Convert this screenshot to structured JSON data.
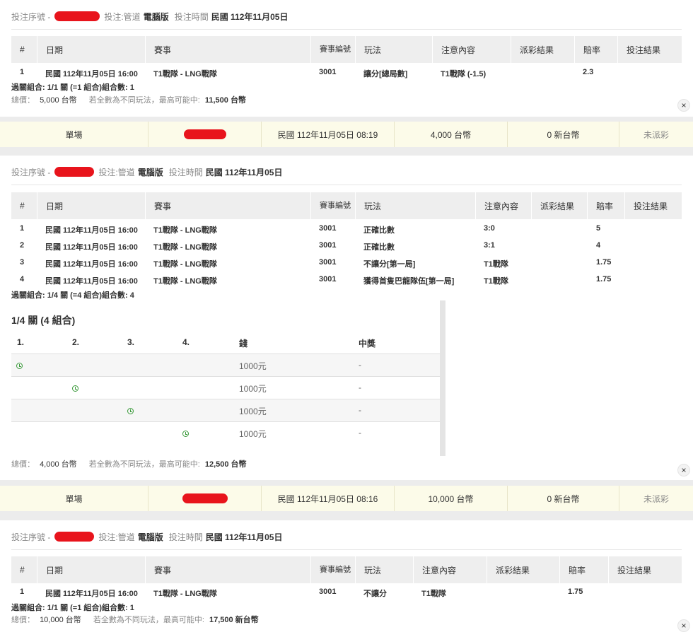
{
  "labels": {
    "bet_serial": "投注序號 -",
    "bet_channel": "投注:管道",
    "bet_channel_value": "電腦版",
    "bet_time": "投注時間",
    "close": "×"
  },
  "columns": {
    "index": "#",
    "date": "日期",
    "event": "賽事",
    "event_no": "賽事編號",
    "play": "玩法",
    "content": "注意內容",
    "payout": "派彩結果",
    "odds": "賠率",
    "result": "投注結果"
  },
  "bet1": {
    "date": "民國 112年11月05日",
    "rows": [
      {
        "no": "1",
        "date": "民國 112年11月05日 16:00",
        "event": "T1戰隊 - LNG戰隊",
        "event_no": "3001",
        "play": "讓分[總局數]",
        "content": "T1戰隊 (-1.5)",
        "odds": "2.3"
      }
    ],
    "summary": "過關組合: 1/1 關 (=1 組合)組合數: 1",
    "total_label": "總價：",
    "total_value": "5,000 台幣",
    "total_note": "若全數為不同玩法，最高可能中:",
    "total_max": "11,500 台幣"
  },
  "bar1": {
    "type": "單場",
    "time": "民國 112年11月05日 08:19",
    "amount": "4,000 台幣",
    "payout": "0 新台幣",
    "status": "未派彩"
  },
  "bet2": {
    "date": "民國 112年11月05日",
    "rows": [
      {
        "no": "1",
        "date": "民國 112年11月05日 16:00",
        "event": "T1戰隊 - LNG戰隊",
        "event_no": "3001",
        "play": "正確比數",
        "content": "3:0",
        "odds": "5"
      },
      {
        "no": "2",
        "date": "民國 112年11月05日 16:00",
        "event": "T1戰隊 - LNG戰隊",
        "event_no": "3001",
        "play": "正確比數",
        "content": "3:1",
        "odds": "4"
      },
      {
        "no": "3",
        "date": "民國 112年11月05日 16:00",
        "event": "T1戰隊 - LNG戰隊",
        "event_no": "3001",
        "play": "不讓分[第一局]",
        "content": "T1戰隊",
        "odds": "1.75"
      },
      {
        "no": "4",
        "date": "民國 112年11月05日 16:00",
        "event": "T1戰隊 - LNG戰隊",
        "event_no": "3001",
        "play": "獲得首隻巴龍隊伍[第一局]",
        "content": "T1戰隊",
        "odds": "1.75"
      }
    ],
    "summary": "過關組合: 1/4 關 (=4 組合)組合數: 4",
    "combo": {
      "title": "1/4 關 (4 組合)",
      "headers": [
        "1.",
        "2.",
        "3.",
        "4.",
        "錢",
        "中獎"
      ],
      "rows": [
        {
          "money": "1000元",
          "win": "-"
        },
        {
          "money": "1000元",
          "win": "-"
        },
        {
          "money": "1000元",
          "win": "-"
        },
        {
          "money": "1000元",
          "win": "-"
        }
      ]
    },
    "total_label": "總價：",
    "total_value": "4,000 台幣",
    "total_note": "若全數為不同玩法，最高可能中:",
    "total_max": "12,500 台幣"
  },
  "bar2": {
    "type": "單場",
    "time": "民國 112年11月05日 08:16",
    "amount": "10,000 台幣",
    "payout": "0 新台幣",
    "status": "未派彩"
  },
  "bet3": {
    "date": "民國 112年11月05日",
    "rows": [
      {
        "no": "1",
        "date": "民國 112年11月05日 16:00",
        "event": "T1戰隊 - LNG戰隊",
        "event_no": "3001",
        "play": "不讓分",
        "content": "T1戰隊",
        "odds": "1.75"
      }
    ],
    "summary": "過關組合: 1/1 關 (=1 組合)組合數: 1",
    "total_label": "總價：",
    "total_value": "10,000 台幣",
    "total_note": "若全數為不同玩法，最高可能中:",
    "total_max": "17,500 新台幣"
  }
}
